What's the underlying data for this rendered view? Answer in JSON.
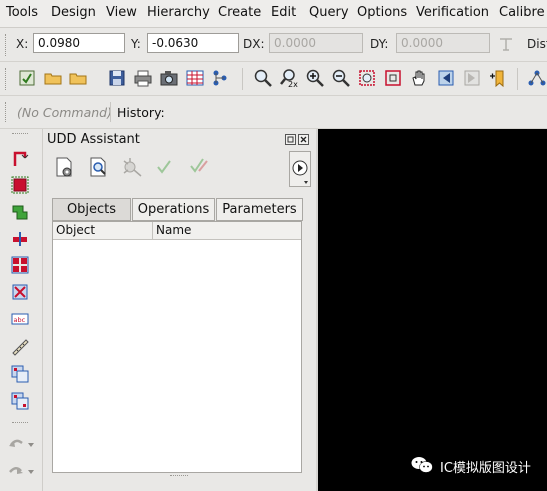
{
  "menu": {
    "items": [
      "Tools",
      "Design",
      "View",
      "Hierarchy",
      "Create",
      "Edit",
      "Query",
      "Options",
      "Verification",
      "Calibre"
    ]
  },
  "coords": {
    "x_label": "X:",
    "x_value": "0.0980",
    "y_label": "Y:",
    "y_value": "-0.0630",
    "dx_label": "DX:",
    "dx_value": "0.0000",
    "dy_label": "DY:",
    "dy_value": "0.0000",
    "dist_label": "Dist"
  },
  "toolbar": {
    "icons": [
      "save-view-icon",
      "open-folder-icon",
      "open-folder-dropdown-icon",
      "save-icon",
      "print-icon",
      "camera-icon",
      "table-grid-icon",
      "hierarchy-tree-icon",
      "zoom-fit-icon",
      "zoom-2x-icon",
      "zoom-in-icon",
      "zoom-out-icon",
      "zoom-select-icon",
      "zoom-box-icon",
      "pan-hand-icon",
      "previous-view-icon",
      "next-view-icon",
      "bookmark-icon",
      "network-icon"
    ]
  },
  "command": {
    "placeholder": "(No Command)",
    "history_label": "History:"
  },
  "panel": {
    "title": "UDD Assistant",
    "tabs": [
      "Objects",
      "Operations",
      "Parameters"
    ],
    "selected_tab": "Objects",
    "columns": [
      "Object",
      "Name"
    ],
    "rows": []
  },
  "watermark": {
    "text": "IC模拟版图设计"
  },
  "colors": {
    "canvas": "#000000",
    "accent_red": "#c8102e",
    "accent_blue": "#2a5db0"
  }
}
